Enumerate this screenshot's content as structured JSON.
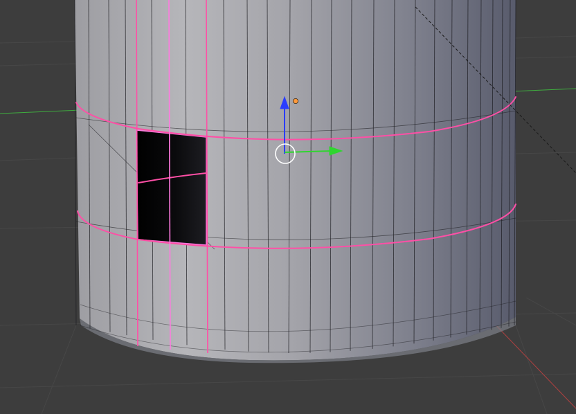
{
  "viewport": {
    "background": "#3d3d3d",
    "grid_color": "#474747",
    "mesh_face_light": "#b4b4b8",
    "mesh_face_dark": "#5e6170",
    "mesh_edge": "#1c1c20",
    "selected_edge": "#ff4fa6",
    "selected_edge_alt": "#ff7ae0",
    "hole_fill": "#050505",
    "axis_x_color": "#b04040",
    "axis_y_color": "#3fae3f",
    "gizmo_z_color": "#2a3cff",
    "gizmo_y_color": "#2fd62f",
    "cursor_color": "#ffffff",
    "origin_color": "#ff9a3c"
  }
}
